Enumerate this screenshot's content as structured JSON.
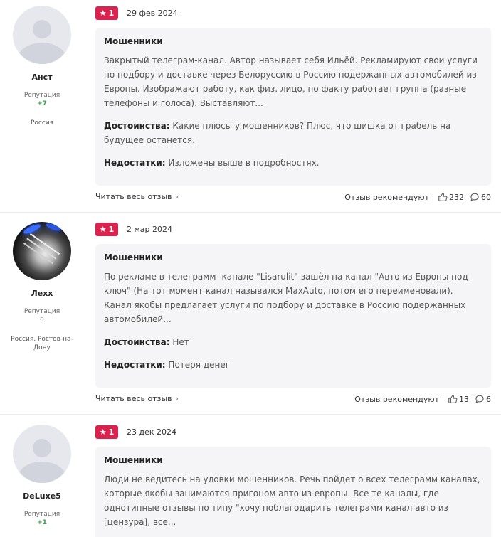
{
  "labels": {
    "reputation": "Репутация",
    "read_full": "Читать весь отзыв",
    "recommend": "Отзыв рекомендуют",
    "pros": "Достоинства:",
    "cons": "Недостатки:"
  },
  "colors": {
    "badge": "#d9234e",
    "reputation_positive": "#3aa64a",
    "card_bg": "#f5f5f7"
  },
  "reviews": [
    {
      "author": "Анст",
      "avatar": "default-avatar",
      "reputation": "+7",
      "location": "Россия",
      "rating": "1",
      "date": "29 фев 2024",
      "title": "Мошенники",
      "text": "Закрытый телеграм-канал. Автор называет себя Ильёй. Рекламируют свои услуги по подбору и доставке через Белоруссию в Россию подержанных автомобилей из Европы. Изображают работу, как физ. лицо, по факту работает группа (разные телефоны и голоса). Выставляют...",
      "pros": "Какие плюсы у мошенников? Плюс, что шишка от грабель на будущее останется.",
      "cons": "Изложены выше в подробностях.",
      "likes": "232",
      "comments": "60"
    },
    {
      "author": "Лехх",
      "avatar": "photo-avatar",
      "reputation": "0",
      "location": "Россия, Ростов-на-Дону",
      "rating": "1",
      "date": "2 мар 2024",
      "title": "Мошенники",
      "text": "По рекламе в телеграмм- канале \"Lisarulit\" зашёл на канал \"Авто из Европы под ключ\" (На тот момент канал назывался MaxAuto, потом его переименовали). Канал якобы предлагает услуги по подбору и доставке в Россию подержанных автомобилей...",
      "pros": "Нет",
      "cons": "Потеря денег",
      "likes": "13",
      "comments": "6"
    },
    {
      "author": "DeLuxe5",
      "avatar": "default-avatar",
      "reputation": "+1",
      "location": "",
      "rating": "1",
      "date": "23 дек 2024",
      "title": "Мошенники",
      "text": "Люди не ведитесь на уловки мошенников. Речь пойдет о всех телеграмм каналах, которые якобы занимаются пригоном авто из европы. Все те каналы, где однотипные отзывы по типу \"хочу поблагодарить телеграмм канал авто из [цензура], все..."
    }
  ]
}
